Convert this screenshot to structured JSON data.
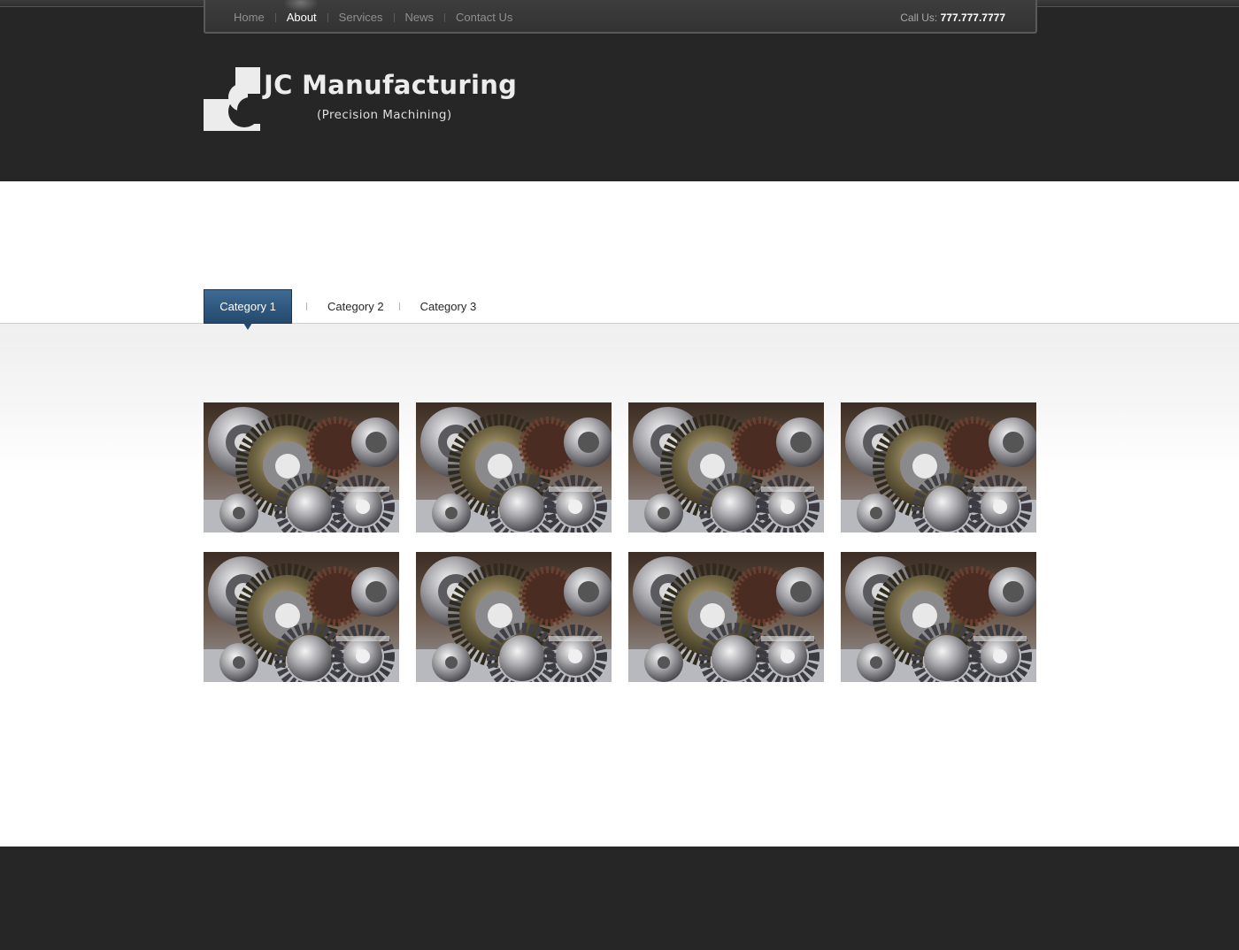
{
  "nav": {
    "items": [
      {
        "label": "Home",
        "active": false
      },
      {
        "label": "About",
        "active": true
      },
      {
        "label": "Services",
        "active": false
      },
      {
        "label": "News",
        "active": false
      },
      {
        "label": "Contact Us",
        "active": false
      }
    ],
    "call_label": "Call Us:",
    "phone": "777.777.7777"
  },
  "logo": {
    "title": "JC Manufacturing",
    "subtitle": "(Precision Machining)"
  },
  "tabs": [
    {
      "label": "Category 1",
      "active": true
    },
    {
      "label": "Category 2",
      "active": false
    },
    {
      "label": "Category 3",
      "active": false
    }
  ],
  "gallery": {
    "image": "gears-photo",
    "count": 8
  },
  "colors": {
    "header_bg": "#262626",
    "active_tab": "#2f5a82",
    "footer_bg": "#262626"
  }
}
